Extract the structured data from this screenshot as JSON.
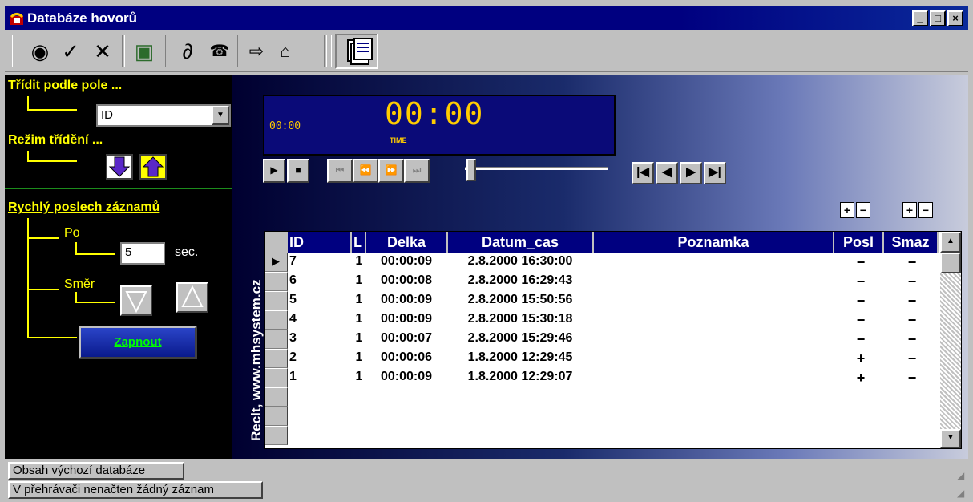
{
  "window": {
    "title": "Databáze hovorů",
    "controls": {
      "minimize": "_",
      "maximize": "□",
      "close": "×"
    }
  },
  "toolbar": {
    "icons": [
      "eye-icon",
      "check-icon",
      "cross-icon",
      "trash-icon",
      "ear-icon",
      "phone-icon",
      "arrow-right-icon",
      "home-icon",
      "database-icon"
    ],
    "glyphs": {
      "eye": "◉",
      "check": "✓",
      "cross": "✕",
      "trash": "▣",
      "ear": "∂",
      "phone": "☎",
      "next": "⇨",
      "home": "⌂",
      "db": "▤"
    }
  },
  "sort": {
    "label": "Třídit podle pole ...",
    "selected": "ID",
    "mode_label": "Režim třídění ..."
  },
  "quick": {
    "label": "Rychlý poslech záznamů",
    "po_label": "Po",
    "seconds_value": "5",
    "sec_label": "sec.",
    "direction_label": "Směr",
    "start_button": "Zapnout"
  },
  "player": {
    "small_time": "00:00",
    "big_time": "00:00",
    "time_label": "TIME",
    "position": 0.0
  },
  "vertical_text": "Reclt, www.mhsystem.cz",
  "grid": {
    "columns": [
      "ID",
      "L",
      "Delka",
      "Datum_cas",
      "Poznamka",
      "Posl",
      "Smaz"
    ],
    "rows": [
      {
        "id": "7",
        "l": "1",
        "delka": "00:00:09",
        "datum": "2.8.2000 16:30:00",
        "poznamka": "",
        "posl": "−",
        "smaz": "−"
      },
      {
        "id": "6",
        "l": "1",
        "delka": "00:00:08",
        "datum": "2.8.2000 16:29:43",
        "poznamka": "",
        "posl": "−",
        "smaz": "−"
      },
      {
        "id": "5",
        "l": "1",
        "delka": "00:00:09",
        "datum": "2.8.2000 15:50:56",
        "poznamka": "",
        "posl": "−",
        "smaz": "−"
      },
      {
        "id": "4",
        "l": "1",
        "delka": "00:00:09",
        "datum": "2.8.2000 15:30:18",
        "poznamka": "",
        "posl": "−",
        "smaz": "−"
      },
      {
        "id": "3",
        "l": "1",
        "delka": "00:00:07",
        "datum": "2.8.2000 15:29:46",
        "poznamka": "",
        "posl": "−",
        "smaz": "−"
      },
      {
        "id": "2",
        "l": "1",
        "delka": "00:00:06",
        "datum": "1.8.2000 12:29:45",
        "poznamka": "",
        "posl": "+",
        "smaz": "−"
      },
      {
        "id": "1",
        "l": "1",
        "delka": "00:00:09",
        "datum": "1.8.2000 12:29:07",
        "poznamka": "",
        "posl": "+",
        "smaz": "−"
      }
    ]
  },
  "status": {
    "line1": "Obsah výchozí databáze",
    "line2": "V přehrávači nenačten žádný záznam"
  }
}
